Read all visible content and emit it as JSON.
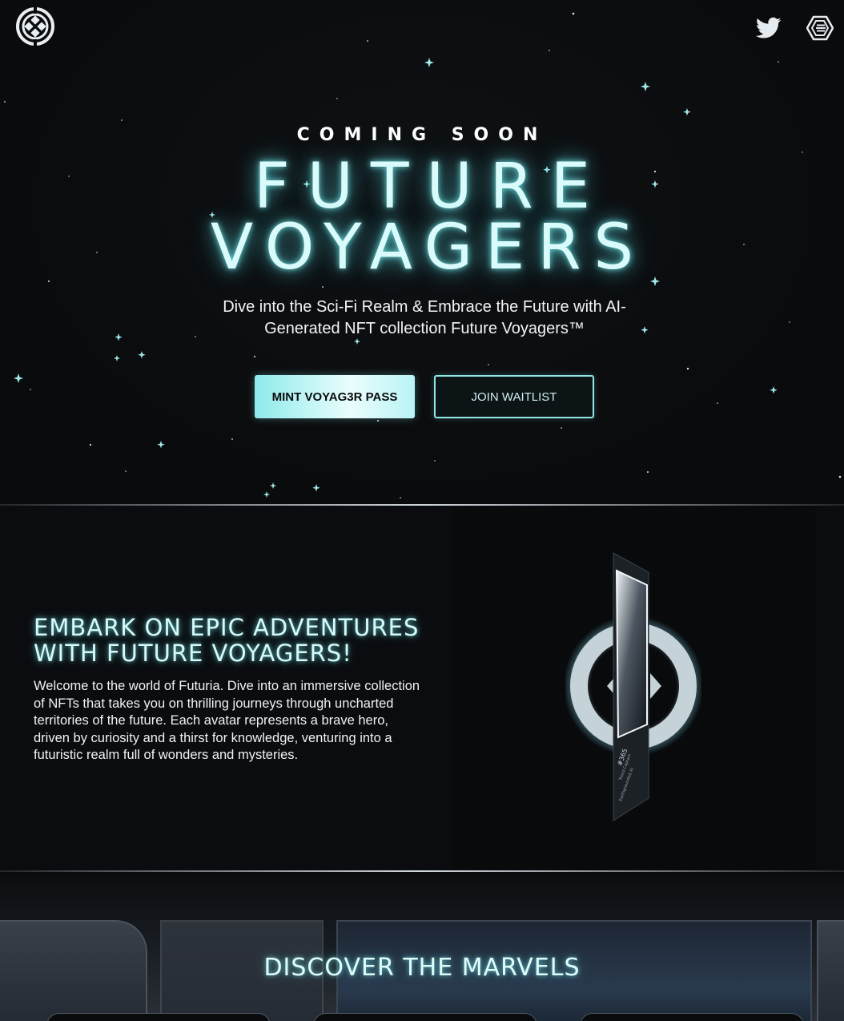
{
  "header": {
    "logo_icon": "voyager-logo-icon",
    "social": [
      {
        "name": "twitter",
        "icon": "twitter-bird-icon"
      },
      {
        "name": "etherscan",
        "icon": "etherscan-icon"
      }
    ]
  },
  "hero": {
    "eyebrow": "COMING SOON",
    "title_line1": "FUTURE",
    "title_line2": "VOYAGERS",
    "subtitle": "Dive into the Sci-Fi Realm & Embrace the Future with AI-Generated NFT collection Future Voyagers™",
    "mint_button": "MINT VOYAG3R PASS",
    "waitlist_button": "JOIN WAITLIST"
  },
  "about": {
    "title": "EMBARK ON EPIC ADVENTURES WITH FUTURE VOYAGERS!",
    "body": "Welcome to the world of Futuria. Dive into an immersive collection of NFTs that takes you on thrilling journeys through uncharted territories of the future. Each avatar represents a brave hero, driven by curiosity and a thirst for knowledge, venturing into a futuristic realm full of wonders and mysteries."
  },
  "marvels": {
    "title": "DISCOVER THE MARVELS"
  },
  "colors": {
    "background": "#0a0b0d",
    "accent": "#8eeaec",
    "glow_text": "#d9fbfb"
  }
}
